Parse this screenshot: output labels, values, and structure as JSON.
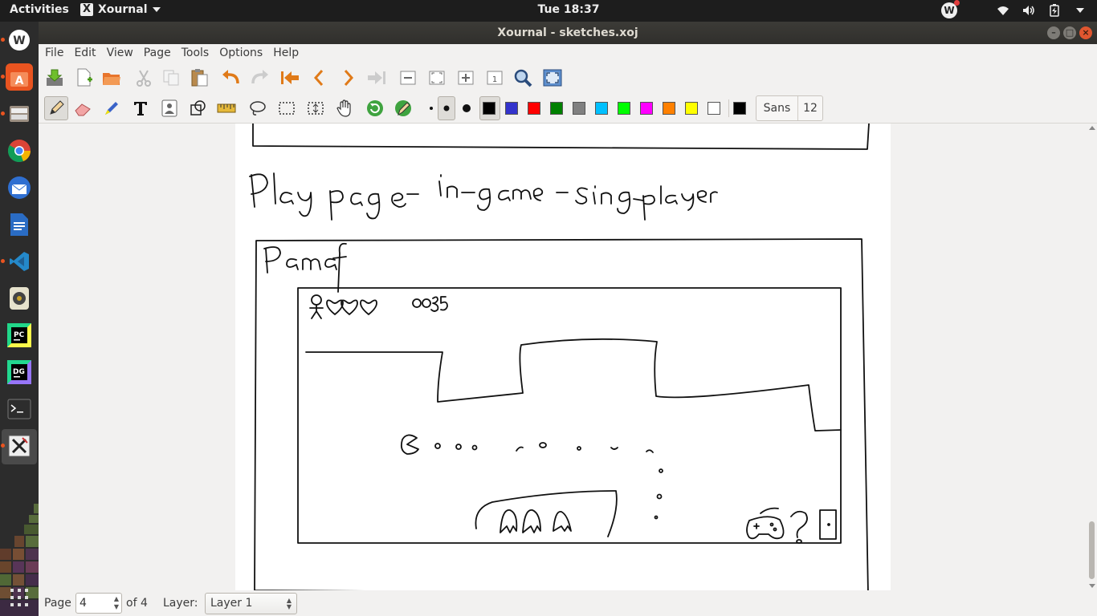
{
  "topbar": {
    "activities": "Activities",
    "app_name": "Xournal",
    "app_icon": "X",
    "clock": "Tue 18:37",
    "tray_avatar": "W",
    "tray_icons": [
      "wifi-icon",
      "volume-icon",
      "battery-icon",
      "power-menu-icon"
    ]
  },
  "dock": {
    "items": [
      {
        "name": "wunderlist",
        "label": "W",
        "color": "#ffffff",
        "bg": "#2c2c2c"
      },
      {
        "name": "ubuntu-software",
        "label": "A",
        "color": "#ffffff",
        "bg": "#e95420"
      },
      {
        "name": "files",
        "label": "",
        "color": "#ffffff",
        "bg": "#7a6e63"
      },
      {
        "name": "chrome",
        "label": "",
        "color": "#ffffff",
        "bg": "#2c2c2c"
      },
      {
        "name": "thunderbird",
        "label": "",
        "color": "#ffffff",
        "bg": "#3d7fd6"
      },
      {
        "name": "libreoffice-writer",
        "label": "",
        "color": "#ffffff",
        "bg": "#2f6ab3"
      },
      {
        "name": "vscode",
        "label": "",
        "color": "#ffffff",
        "bg": "#2c2c2c"
      },
      {
        "name": "rhythmbox",
        "label": "",
        "color": "#ffffff",
        "bg": "#e5e1c9"
      },
      {
        "name": "pycharm",
        "label": "PC",
        "color": "#ffffff",
        "bg": "#1c1c1c"
      },
      {
        "name": "datagrip",
        "label": "DG",
        "color": "#ffffff",
        "bg": "#1c1c1c"
      },
      {
        "name": "terminal",
        "label": ">_",
        "color": "#ffffff",
        "bg": "#3a3a3a"
      },
      {
        "name": "xournal",
        "label": "X",
        "color": "#222222",
        "bg": "#eeeeee"
      }
    ]
  },
  "window": {
    "title": "Xournal - sketches.xoj",
    "controls": [
      "–",
      "□",
      "×"
    ]
  },
  "menubar": {
    "items": [
      "File",
      "Edit",
      "View",
      "Page",
      "Tools",
      "Options",
      "Help"
    ]
  },
  "toolbar": {
    "colors": [
      "#000000",
      "#3333cc",
      "#ff0000",
      "#008000",
      "#808080",
      "#00c0ff",
      "#00ff00",
      "#ff00ff",
      "#ff8000",
      "#ffff00",
      "#ffffff"
    ],
    "current_color": "#000000",
    "font_name": "Sans",
    "font_size": "12"
  },
  "statusbar": {
    "page_label": "Page",
    "page_value": "4",
    "of_label": "of 4",
    "layer_label": "Layer:",
    "layer_value": "Layer 1"
  }
}
